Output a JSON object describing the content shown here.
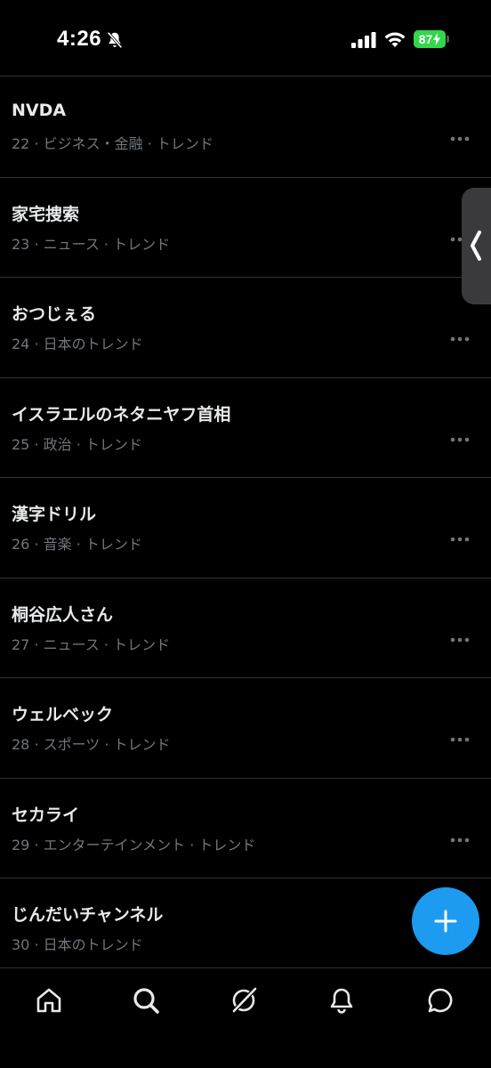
{
  "status_bar": {
    "time": "4:26",
    "battery_level": "87",
    "icons": [
      "bell-slash-icon",
      "cellular-signal-icon",
      "wifi-icon",
      "battery-charging-icon"
    ]
  },
  "trends": [
    {
      "title": "NVDA",
      "meta": "22 · ビジネス・金融 · トレンド"
    },
    {
      "title": "家宅捜索",
      "meta": "23 · ニュース · トレンド"
    },
    {
      "title": "おつじぇる",
      "meta": "24 · 日本のトレンド"
    },
    {
      "title": "イスラエルのネタニヤフ首相",
      "meta": "25 · 政治 · トレンド"
    },
    {
      "title": "漢字ドリル",
      "meta": "26 · 音楽 · トレンド"
    },
    {
      "title": "桐谷広人さん",
      "meta": "27 · ニュース · トレンド"
    },
    {
      "title": "ウェルベック",
      "meta": "28 · スポーツ · トレンド"
    },
    {
      "title": "セカライ",
      "meta": "29 · エンターテインメント · トレンド"
    },
    {
      "title": "じんだいチャンネル",
      "meta": "30 · 日本のトレンド"
    }
  ],
  "fab": {
    "icon": "plus-icon"
  },
  "bottom_nav": [
    "home-icon",
    "search-icon",
    "grok-icon",
    "notifications-icon",
    "messages-icon"
  ],
  "colors": {
    "background": "#000000",
    "text_primary": "#e7e9ea",
    "text_secondary": "#71767b",
    "divider": "#2f3336",
    "accent": "#1d9bf0",
    "battery": "#32d74b"
  }
}
